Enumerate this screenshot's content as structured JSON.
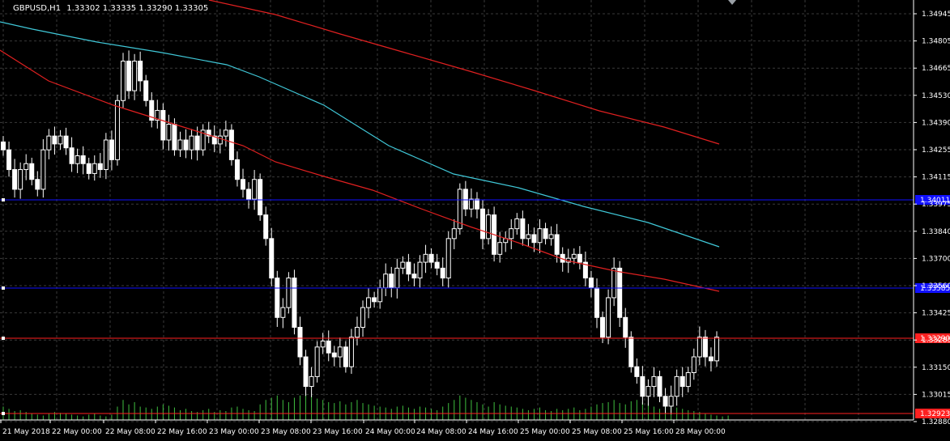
{
  "header": {
    "symbol": "GBPUSD,H1",
    "ohlc": "1.33302 1.33335 1.33290 1.33305"
  },
  "colors": {
    "background": "#000000",
    "grid": "#3a3a3a",
    "candle_up": "#000000",
    "candle_down": "#ffffff",
    "wick": "#ffffff",
    "volume": "#3fbf3f",
    "ma_fast": "#e02020",
    "ma_slow": "#40c8d8",
    "ma_long": "#e02020",
    "hline_blue": "#1010ff",
    "hline_red": "#ff2020"
  },
  "chart_data": {
    "type": "candlestick",
    "title": "GBPUSD,H1",
    "y_ticks": [
      "1.34945",
      "1.34805",
      "1.34665",
      "1.34530",
      "1.34390",
      "1.34255",
      "1.34115",
      "1.33975",
      "1.33840",
      "1.33700",
      "1.33560",
      "1.33425",
      "1.33285",
      "1.33150",
      "1.33015",
      "1.32880"
    ],
    "ylim": [
      1.3288,
      1.3501
    ],
    "x_ticks": [
      "21 May 2018",
      "22 May 00:00",
      "22 May 08:00",
      "22 May 16:00",
      "23 May 00:00",
      "23 May 08:00",
      "23 May 16:00",
      "24 May 00:00",
      "24 May 08:00",
      "24 May 16:00",
      "25 May 00:00",
      "25 May 08:00",
      "25 May 16:00",
      "28 May 00:00"
    ],
    "price_levels": [
      {
        "label": "1.34011",
        "price": 1.34011,
        "kind": "blue"
      },
      {
        "label": "1.33585",
        "price": 1.33585,
        "kind": "blue"
      },
      {
        "label": "1.33290",
        "price": 1.3329,
        "kind": "red"
      },
      {
        "label": "1.32923",
        "price": 1.32923,
        "kind": "red"
      }
    ],
    "close_prices": [
      1.3425,
      1.3415,
      1.3405,
      1.3415,
      1.3418,
      1.341,
      1.3405,
      1.3425,
      1.3432,
      1.3428,
      1.3432,
      1.3426,
      1.3418,
      1.3422,
      1.3418,
      1.3413,
      1.3418,
      1.3415,
      1.343,
      1.342,
      1.345,
      1.347,
      1.3455,
      1.347,
      1.346,
      1.345,
      1.344,
      1.3445,
      1.343,
      1.3438,
      1.3425,
      1.343,
      1.3425,
      1.3432,
      1.3425,
      1.3435,
      1.3432,
      1.3428,
      1.3432,
      1.3435,
      1.342,
      1.341,
      1.3405,
      1.34,
      1.341,
      1.3392,
      1.338,
      1.336,
      1.334,
      1.3345,
      1.336,
      1.3335,
      1.332,
      1.3305,
      1.331,
      1.3325,
      1.3328,
      1.3322,
      1.332,
      1.3325,
      1.3315,
      1.333,
      1.3335,
      1.3345,
      1.335,
      1.3348,
      1.3355,
      1.3362,
      1.3355,
      1.3365,
      1.3368,
      1.3362,
      1.336,
      1.3368,
      1.3372,
      1.3368,
      1.3365,
      1.336,
      1.338,
      1.3385,
      1.3405,
      1.3395,
      1.34,
      1.3395,
      1.338,
      1.3392,
      1.3372,
      1.3378,
      1.338,
      1.3385,
      1.339,
      1.338,
      1.3382,
      1.3378,
      1.3385,
      1.338,
      1.3382,
      1.3372,
      1.3368,
      1.337,
      1.3372,
      1.3368,
      1.336,
      1.3355,
      1.334,
      1.333,
      1.335,
      1.3365,
      1.334,
      1.333,
      1.3315,
      1.331,
      1.33,
      1.3305,
      1.331,
      1.33,
      1.3295,
      1.33,
      1.331,
      1.3305,
      1.3312,
      1.332,
      1.333,
      1.332,
      1.3318,
      1.333
    ],
    "volume_pct": [
      30,
      25,
      20,
      22,
      18,
      15,
      12,
      10,
      14,
      18,
      16,
      14,
      12,
      10,
      8,
      12,
      15,
      10,
      8,
      12,
      30,
      45,
      35,
      40,
      30,
      28,
      25,
      30,
      35,
      32,
      28,
      22,
      25,
      20,
      18,
      22,
      25,
      18,
      22,
      20,
      28,
      30,
      25,
      22,
      20,
      35,
      45,
      50,
      55,
      45,
      40,
      50,
      55,
      60,
      55,
      48,
      45,
      40,
      38,
      42,
      35,
      40,
      45,
      38,
      35,
      32,
      30,
      28,
      25,
      30,
      32,
      28,
      25,
      30,
      28,
      25,
      22,
      30,
      38,
      45,
      55,
      50,
      45,
      40,
      35,
      30,
      40,
      35,
      32,
      30,
      28,
      25,
      22,
      25,
      28,
      22,
      20,
      25,
      22,
      25,
      28,
      22,
      25,
      30,
      35,
      38,
      40,
      45,
      38,
      35,
      42,
      45,
      40,
      38,
      30,
      25,
      35,
      30,
      28,
      25,
      22,
      20,
      18,
      15,
      12,
      10,
      8,
      10
    ],
    "ma_slow": [
      [
        0,
        27
      ],
      [
        40,
        36
      ],
      [
        120,
        52
      ],
      [
        200,
        65
      ],
      [
        280,
        80
      ],
      [
        320,
        95
      ],
      [
        400,
        130
      ],
      [
        480,
        180
      ],
      [
        560,
        215
      ],
      [
        640,
        232
      ],
      [
        720,
        255
      ],
      [
        800,
        275
      ],
      [
        888,
        305
      ]
    ],
    "ma_fast": [
      [
        0,
        62
      ],
      [
        60,
        100
      ],
      [
        140,
        130
      ],
      [
        220,
        155
      ],
      [
        300,
        180
      ],
      [
        340,
        200
      ],
      [
        400,
        218
      ],
      [
        460,
        235
      ],
      [
        520,
        258
      ],
      [
        580,
        280
      ],
      [
        640,
        300
      ],
      [
        700,
        322
      ],
      [
        760,
        335
      ],
      [
        820,
        345
      ],
      [
        888,
        360
      ]
    ],
    "ma_long": [
      [
        258,
        0
      ],
      [
        340,
        18
      ],
      [
        420,
        42
      ],
      [
        500,
        65
      ],
      [
        580,
        88
      ],
      [
        660,
        112
      ],
      [
        740,
        137
      ],
      [
        820,
        157
      ],
      [
        888,
        178
      ]
    ]
  }
}
